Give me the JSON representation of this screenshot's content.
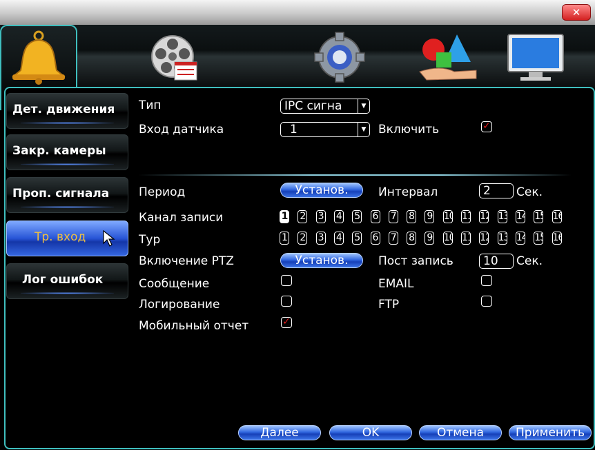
{
  "tabs": [
    {
      "icon": "film-reel-icon"
    },
    {
      "icon": "bell-icon",
      "active": true
    },
    {
      "icon": "gear-icon"
    },
    {
      "icon": "shapes-hand-icon"
    },
    {
      "icon": "monitor-icon"
    }
  ],
  "menu": {
    "items": [
      {
        "label": "Дет. движения"
      },
      {
        "label": "Закр. камеры"
      },
      {
        "label": "Проп. сигнала"
      },
      {
        "label": "Тр. вход",
        "active": true
      },
      {
        "label": "Лог ошибок"
      }
    ]
  },
  "form": {
    "type_label": "Тип",
    "type_value": "IPC сигна",
    "sensor_label": "Вход датчика",
    "sensor_value": "1",
    "enable_label": "Включить",
    "enable_checked": true,
    "period_label": "Период",
    "set_button": "Установ.",
    "interval_label": "Интервал",
    "interval_value": "2",
    "sec_label": "Сек.",
    "record_channel_label": "Канал записи",
    "tour_label": "Тур",
    "channels": [
      "1",
      "2",
      "3",
      "4",
      "5",
      "6",
      "7",
      "8",
      "9",
      "10",
      "11",
      "12",
      "13",
      "14",
      "15",
      "16"
    ],
    "record_channel_selected": [
      "1"
    ],
    "ptz_label": "Включение PTZ",
    "ptz_button": "Установ.",
    "post_record_label": "Пост запись",
    "post_record_value": "10",
    "post_sec_label": "Сек.",
    "message_label": "Сообщение",
    "message_checked": false,
    "email_label": "EMAIL",
    "email_checked": false,
    "logging_label": "Логирование",
    "logging_checked": false,
    "ftp_label": "FTP",
    "ftp_checked": false,
    "mobile_label": "Мобильный отчет",
    "mobile_checked": true
  },
  "buttons": {
    "next": "Далее",
    "ok": "OK",
    "cancel": "Отмена",
    "apply": "Применить"
  },
  "colors": {
    "accent": "#3fbfbf",
    "button_blue": "#3268e0",
    "active_menu_text": "#f0c040",
    "checkmark": "#e01b1b"
  }
}
